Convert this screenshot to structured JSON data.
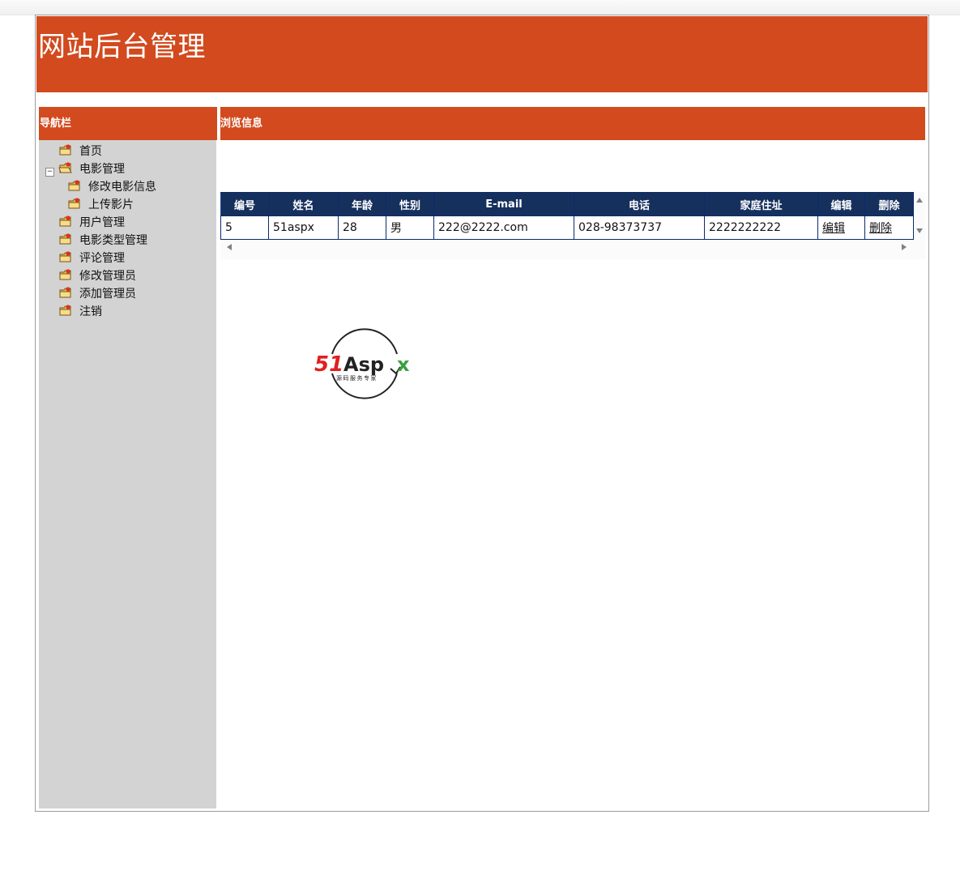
{
  "header": {
    "title": "网站后台管理",
    "bg_color": "#d24a1e"
  },
  "sidebar": {
    "heading": "导航栏",
    "bg_color": "#d3d3d3",
    "tree": [
      {
        "label": "首页",
        "level": 0,
        "icon": "folder-star-icon"
      },
      {
        "label": "电影管理",
        "level": 0,
        "icon": "folder-open-icon",
        "expanded": true,
        "toggle": "−"
      },
      {
        "label": "修改电影信息",
        "level": 1,
        "icon": "folder-star-icon"
      },
      {
        "label": "上传影片",
        "level": 1,
        "icon": "folder-star-icon"
      },
      {
        "label": "用户管理",
        "level": 0,
        "icon": "folder-star-icon"
      },
      {
        "label": "电影类型管理",
        "level": 0,
        "icon": "folder-star-icon"
      },
      {
        "label": "评论管理",
        "level": 0,
        "icon": "folder-star-icon"
      },
      {
        "label": "修改管理员",
        "level": 0,
        "icon": "folder-star-icon"
      },
      {
        "label": "添加管理员",
        "level": 0,
        "icon": "folder-star-icon"
      },
      {
        "label": "注销",
        "level": 0,
        "icon": "folder-star-icon"
      }
    ]
  },
  "main": {
    "heading": "浏览信息",
    "grid": {
      "header_color": "#16305e",
      "columns": [
        "编号",
        "姓名",
        "年龄",
        "性别",
        "E-mail",
        "电话",
        "家庭住址",
        "编辑",
        "删除"
      ],
      "rows": [
        {
          "id": "5",
          "name": "51aspx",
          "age": "28",
          "gender": "男",
          "email": "222@2222.com",
          "phone": "028-98373737",
          "address": "2222222222",
          "edit": "编辑",
          "delete": "删除"
        }
      ]
    }
  },
  "logo": {
    "text_red": "51",
    "text_black": "Asp",
    "text_green": "x",
    "tagline": "源码服务专家"
  }
}
